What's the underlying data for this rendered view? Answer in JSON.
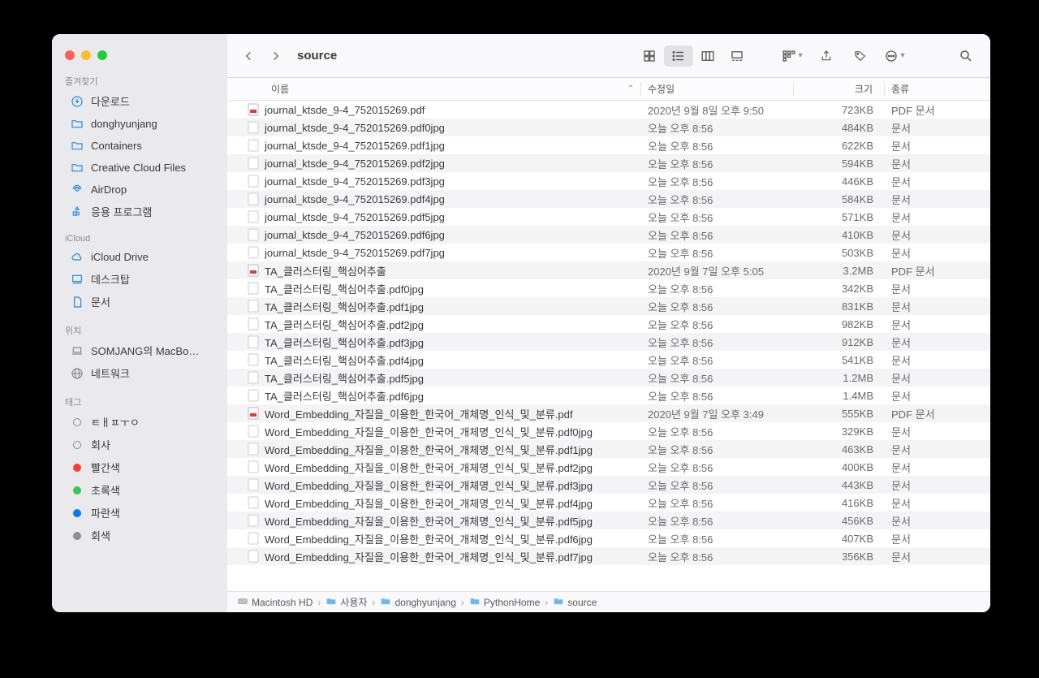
{
  "window_title": "source",
  "sidebar": {
    "favorites_label": "즐겨찾기",
    "favorites": [
      {
        "icon": "download",
        "label": "다운로드"
      },
      {
        "icon": "folder",
        "label": "donghyunjang"
      },
      {
        "icon": "folder",
        "label": "Containers"
      },
      {
        "icon": "folder",
        "label": "Creative Cloud Files"
      },
      {
        "icon": "airdrop",
        "label": "AirDrop"
      },
      {
        "icon": "apps",
        "label": "응용 프로그램"
      }
    ],
    "icloud_label": "iCloud",
    "icloud": [
      {
        "icon": "cloud",
        "label": "iCloud Drive"
      },
      {
        "icon": "desktop",
        "label": "데스크탑"
      },
      {
        "icon": "doc",
        "label": "문서"
      }
    ],
    "locations_label": "위치",
    "locations": [
      {
        "icon": "laptop",
        "label": "SOMJANG의 MacBo…"
      },
      {
        "icon": "network",
        "label": "네트워크"
      }
    ],
    "tags_label": "태그",
    "tags": [
      {
        "color": "",
        "label": "ㅌㅐㅍㅜㅇ"
      },
      {
        "color": "",
        "label": "회사"
      },
      {
        "color": "#ff3b30",
        "label": "빨간색"
      },
      {
        "color": "#34c759",
        "label": "초록색"
      },
      {
        "color": "#007aff",
        "label": "파란색"
      },
      {
        "color": "#8e8e93",
        "label": "회색"
      }
    ]
  },
  "columns": {
    "name": "이름",
    "modified": "수정일",
    "size": "크기",
    "kind": "종류"
  },
  "files": [
    {
      "icon": "pdf",
      "name": "journal_ktsde_9-4_752015269.pdf",
      "mod": "2020년 9월 8일 오후 9:50",
      "size": "723KB",
      "kind": "PDF 문서"
    },
    {
      "icon": "blank",
      "name": "journal_ktsde_9-4_752015269.pdf0jpg",
      "mod": "오늘 오후 8:56",
      "size": "484KB",
      "kind": "문서"
    },
    {
      "icon": "blank",
      "name": "journal_ktsde_9-4_752015269.pdf1jpg",
      "mod": "오늘 오후 8:56",
      "size": "622KB",
      "kind": "문서"
    },
    {
      "icon": "blank",
      "name": "journal_ktsde_9-4_752015269.pdf2jpg",
      "mod": "오늘 오후 8:56",
      "size": "594KB",
      "kind": "문서"
    },
    {
      "icon": "blank",
      "name": "journal_ktsde_9-4_752015269.pdf3jpg",
      "mod": "오늘 오후 8:56",
      "size": "446KB",
      "kind": "문서"
    },
    {
      "icon": "blank",
      "name": "journal_ktsde_9-4_752015269.pdf4jpg",
      "mod": "오늘 오후 8:56",
      "size": "584KB",
      "kind": "문서"
    },
    {
      "icon": "blank",
      "name": "journal_ktsde_9-4_752015269.pdf5jpg",
      "mod": "오늘 오후 8:56",
      "size": "571KB",
      "kind": "문서"
    },
    {
      "icon": "blank",
      "name": "journal_ktsde_9-4_752015269.pdf6jpg",
      "mod": "오늘 오후 8:56",
      "size": "410KB",
      "kind": "문서"
    },
    {
      "icon": "blank",
      "name": "journal_ktsde_9-4_752015269.pdf7jpg",
      "mod": "오늘 오후 8:56",
      "size": "503KB",
      "kind": "문서"
    },
    {
      "icon": "pdf",
      "name": "TA_클러스터링_핵심어추출",
      "mod": "2020년 9월 7일 오후 5:05",
      "size": "3.2MB",
      "kind": "PDF 문서"
    },
    {
      "icon": "blank",
      "name": "TA_클러스터링_핵심어추출.pdf0jpg",
      "mod": "오늘 오후 8:56",
      "size": "342KB",
      "kind": "문서"
    },
    {
      "icon": "blank",
      "name": "TA_클러스터링_핵심어추출.pdf1jpg",
      "mod": "오늘 오후 8:56",
      "size": "831KB",
      "kind": "문서"
    },
    {
      "icon": "blank",
      "name": "TA_클러스터링_핵심어추출.pdf2jpg",
      "mod": "오늘 오후 8:56",
      "size": "982KB",
      "kind": "문서"
    },
    {
      "icon": "blank",
      "name": "TA_클러스터링_핵심어추출.pdf3jpg",
      "mod": "오늘 오후 8:56",
      "size": "912KB",
      "kind": "문서"
    },
    {
      "icon": "blank",
      "name": "TA_클러스터링_핵심어추출.pdf4jpg",
      "mod": "오늘 오후 8:56",
      "size": "541KB",
      "kind": "문서"
    },
    {
      "icon": "blank",
      "name": "TA_클러스터링_핵심어추출.pdf5jpg",
      "mod": "오늘 오후 8:56",
      "size": "1.2MB",
      "kind": "문서"
    },
    {
      "icon": "blank",
      "name": "TA_클러스터링_핵심어추출.pdf6jpg",
      "mod": "오늘 오후 8:56",
      "size": "1.4MB",
      "kind": "문서"
    },
    {
      "icon": "pdf",
      "name": "Word_Embedding_자질을_이용한_한국어_개체명_인식_및_분류.pdf",
      "mod": "2020년 9월 7일 오후 3:49",
      "size": "555KB",
      "kind": "PDF 문서"
    },
    {
      "icon": "blank",
      "name": "Word_Embedding_자질을_이용한_한국어_개체명_인식_및_분류.pdf0jpg",
      "mod": "오늘 오후 8:56",
      "size": "329KB",
      "kind": "문서"
    },
    {
      "icon": "blank",
      "name": "Word_Embedding_자질을_이용한_한국어_개체명_인식_및_분류.pdf1jpg",
      "mod": "오늘 오후 8:56",
      "size": "463KB",
      "kind": "문서"
    },
    {
      "icon": "blank",
      "name": "Word_Embedding_자질을_이용한_한국어_개체명_인식_및_분류.pdf2jpg",
      "mod": "오늘 오후 8:56",
      "size": "400KB",
      "kind": "문서"
    },
    {
      "icon": "blank",
      "name": "Word_Embedding_자질을_이용한_한국어_개체명_인식_및_분류.pdf3jpg",
      "mod": "오늘 오후 8:56",
      "size": "443KB",
      "kind": "문서"
    },
    {
      "icon": "blank",
      "name": "Word_Embedding_자질을_이용한_한국어_개체명_인식_및_분류.pdf4jpg",
      "mod": "오늘 오후 8:56",
      "size": "416KB",
      "kind": "문서"
    },
    {
      "icon": "blank",
      "name": "Word_Embedding_자질을_이용한_한국어_개체명_인식_및_분류.pdf5jpg",
      "mod": "오늘 오후 8:56",
      "size": "456KB",
      "kind": "문서"
    },
    {
      "icon": "blank",
      "name": "Word_Embedding_자질을_이용한_한국어_개체명_인식_및_분류.pdf6jpg",
      "mod": "오늘 오후 8:56",
      "size": "407KB",
      "kind": "문서"
    },
    {
      "icon": "blank",
      "name": "Word_Embedding_자질을_이용한_한국어_개체명_인식_및_분류.pdf7jpg",
      "mod": "오늘 오후 8:56",
      "size": "356KB",
      "kind": "문서"
    }
  ],
  "path": [
    {
      "icon": "disk",
      "label": "Macintosh HD"
    },
    {
      "icon": "folder",
      "label": "사용자"
    },
    {
      "icon": "folder",
      "label": "donghyunjang"
    },
    {
      "icon": "folder",
      "label": "PythonHome"
    },
    {
      "icon": "folder",
      "label": "source"
    }
  ]
}
